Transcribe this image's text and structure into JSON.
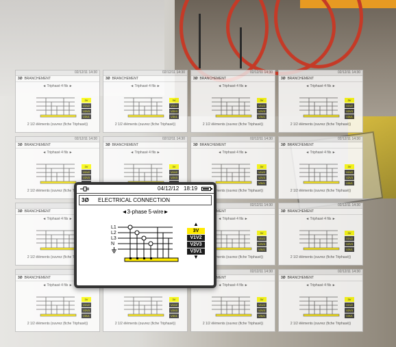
{
  "tile_header": "BRANCHEMENT",
  "tile_datetime": "02/12/11  14:30",
  "tile_subtitle": "◄ Triphasé 4 fils ►",
  "tile_footer": "2 1/2 éléments (ouvrez (fiche Triphasé))",
  "tile_badges": [
    "3V",
    "V1V2",
    "V2V3",
    "V3V1"
  ],
  "screen": {
    "date": "04/12/12",
    "time": "18:19",
    "phase_symbol": "3Ø",
    "title": "ELECTRICAL CONNECTION",
    "mode": "◄3-phase 5-wire►",
    "line_labels": [
      "L1",
      "L2",
      "L3",
      "N"
    ],
    "selector_up": "▲",
    "selector_down": "▼",
    "options": [
      "3V",
      "V1V2",
      "V2V3",
      "V3V1"
    ],
    "active_option": "3V"
  },
  "colors": {
    "highlight": "#ffea00",
    "coil": "#c53a27",
    "accent": "#e79a22"
  },
  "icons": [
    "plug-icon",
    "battery-icon",
    "ground-icon"
  ]
}
